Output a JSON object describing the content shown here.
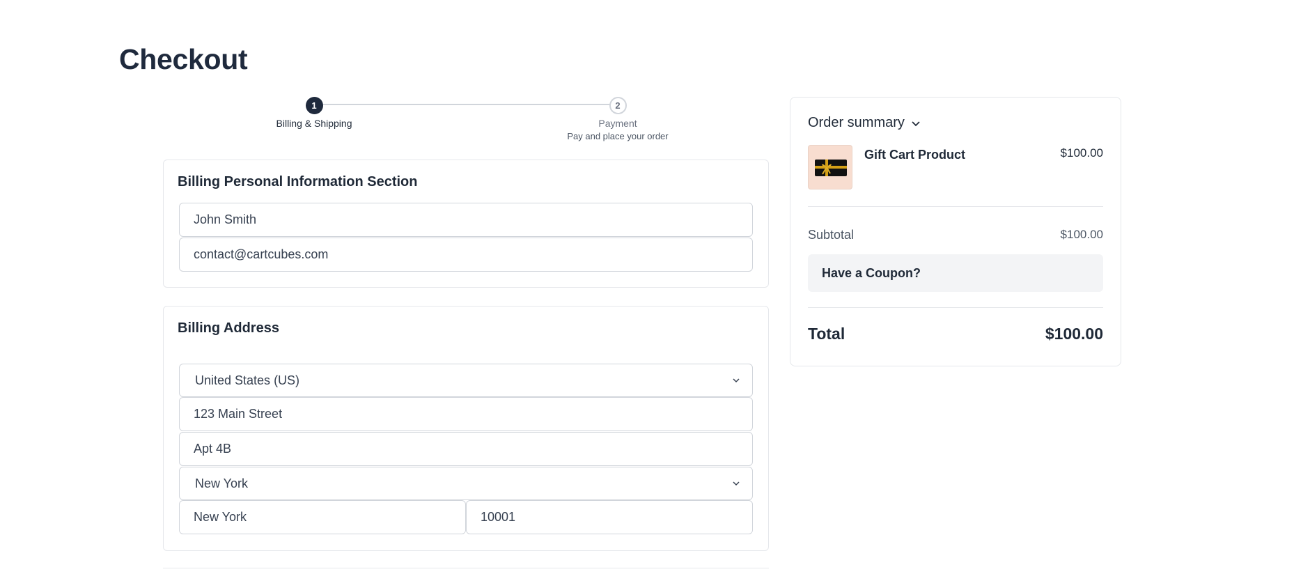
{
  "page": {
    "title": "Checkout"
  },
  "stepper": {
    "steps": [
      {
        "number": "1",
        "label": "Billing & Shipping",
        "sublabel": ""
      },
      {
        "number": "2",
        "label": "Payment",
        "sublabel": "Pay and place your order"
      }
    ]
  },
  "billing_personal": {
    "title": "Billing Personal Information Section",
    "name": "John Smith",
    "email": "contact@cartcubes.com"
  },
  "billing_address": {
    "title": "Billing Address",
    "country": "United States (US)",
    "address1": "123 Main Street",
    "address2": "Apt 4B",
    "state": "New York",
    "city": "New York",
    "zip": "10001"
  },
  "summary": {
    "title": "Order summary",
    "product_name": "Gift Cart Product",
    "product_price": "$100.00",
    "subtotal_label": "Subtotal",
    "subtotal_value": "$100.00",
    "coupon_label": "Have a Coupon?",
    "total_label": "Total",
    "total_value": "$100.00"
  },
  "icons": {
    "summary_toggle": "chevron-down-icon",
    "select_arrow": "chevron-down-icon",
    "product_thumb": "gift-card-image"
  }
}
